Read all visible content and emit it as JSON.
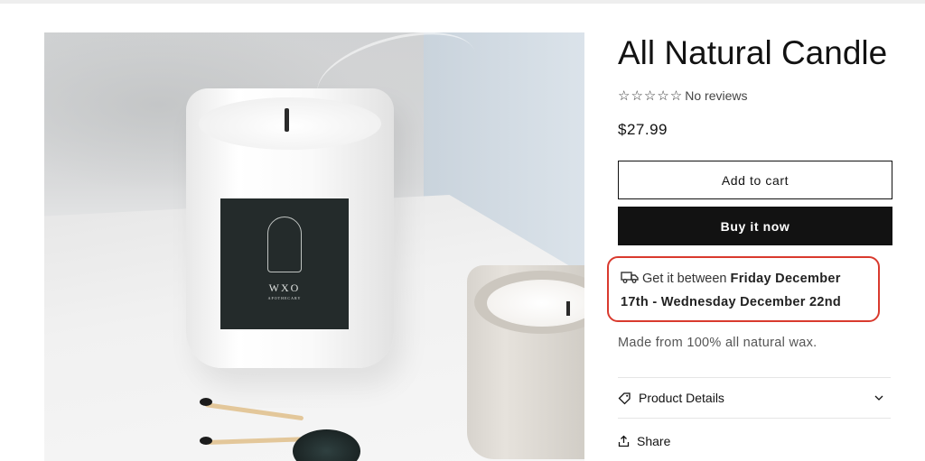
{
  "product": {
    "title": "All Natural Candle",
    "rating": {
      "stars": "☆☆☆☆☆",
      "score": 0,
      "max": 5,
      "label": "No reviews"
    },
    "price": "$27.99",
    "image": {
      "brand": "WXO",
      "sub": "APOTHECARY"
    },
    "add_to_cart_label": "Add to cart",
    "buy_now_label": "Buy it now",
    "delivery": {
      "prefix": "Get it between",
      "range_line1": "Friday December",
      "range_line2": "17th - Wednesday December 22nd",
      "highlight_color": "#d93a2e"
    },
    "description": "Made from 100% all natural wax.",
    "accordion": {
      "details_label": "Product Details",
      "share_label": "Share"
    }
  },
  "icons": {
    "truck": "truck-icon",
    "tag": "tag-icon",
    "share": "share-icon",
    "chevron": "chevron-down-icon"
  }
}
